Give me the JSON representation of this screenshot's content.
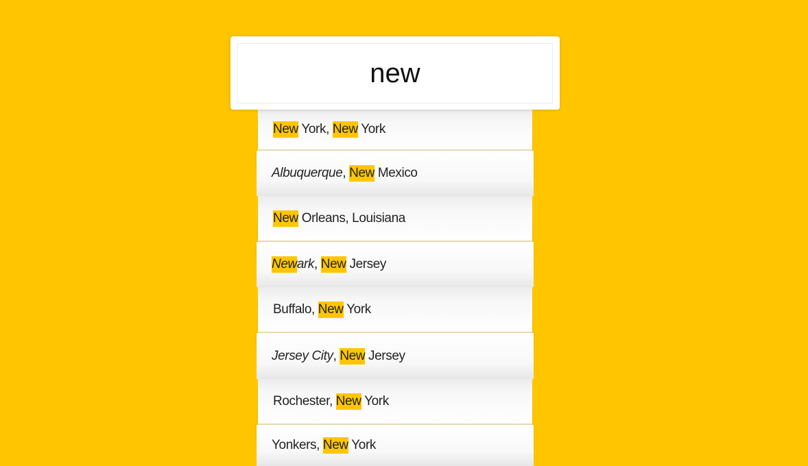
{
  "search": {
    "value": "new"
  },
  "highlight_color": "#ffc600",
  "background_color": "#ffc600",
  "suggestions": [
    {
      "parts": [
        {
          "text": "New",
          "hl": true
        },
        {
          "text": " York, "
        },
        {
          "text": "New",
          "hl": true
        },
        {
          "text": " York"
        }
      ]
    },
    {
      "parts": [
        {
          "text": "Albuquerque",
          "italic": true
        },
        {
          "text": ", "
        },
        {
          "text": "New",
          "hl": true
        },
        {
          "text": " Mexico"
        }
      ]
    },
    {
      "parts": [
        {
          "text": "New",
          "hl": true
        },
        {
          "text": " Orleans, Louisiana"
        }
      ]
    },
    {
      "parts": [
        {
          "text": "New",
          "hl": true,
          "italic": true
        },
        {
          "text": "ark",
          "italic": true
        },
        {
          "text": ", "
        },
        {
          "text": "New",
          "hl": true
        },
        {
          "text": " Jersey"
        }
      ]
    },
    {
      "parts": [
        {
          "text": "Buffalo, "
        },
        {
          "text": "New",
          "hl": true
        },
        {
          "text": " York"
        }
      ]
    },
    {
      "parts": [
        {
          "text": "Jersey City",
          "italic": true
        },
        {
          "text": ", "
        },
        {
          "text": "New",
          "hl": true
        },
        {
          "text": " Jersey"
        }
      ]
    },
    {
      "parts": [
        {
          "text": "Rochester, "
        },
        {
          "text": "New",
          "hl": true
        },
        {
          "text": " York"
        }
      ]
    },
    {
      "parts": [
        {
          "text": "Yonkers, "
        },
        {
          "text": "New",
          "hl": true
        },
        {
          "text": " York"
        }
      ]
    }
  ]
}
